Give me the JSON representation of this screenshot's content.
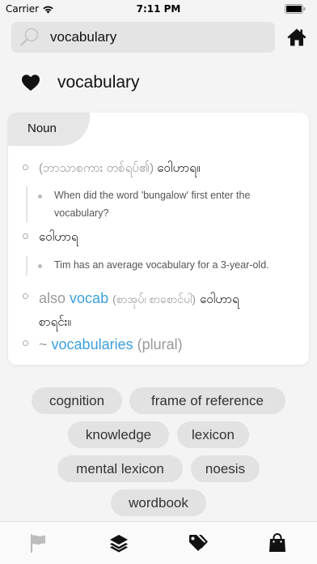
{
  "status_bar": {
    "carrier": "Carrier",
    "time": "7:11 PM"
  },
  "search": {
    "value": "vocabulary"
  },
  "entry": {
    "headword": "vocabulary",
    "part_of_speech": "Noun",
    "definition_1": {
      "note": "(ဘာသာစကား တစ်ရပ်၏)",
      "gloss": "ဝေါဟာရ။"
    },
    "example_1": "When did the word 'bungalow' first enter the vocabulary?",
    "definition_2": {
      "gloss": "ဝေါဟာရ"
    },
    "example_2": "Tim has an average vocabulary for a 3-year-old.",
    "variant": {
      "prefix": "also",
      "word": "vocab",
      "note": "(စာအုပ်၊ စာစောင်ပါ)",
      "gloss": "ဝေါဟာရ",
      "gloss_cont": "စာရင်း။"
    },
    "plural": {
      "tilde": "~",
      "word": "vocabularies",
      "label": "(plural)"
    }
  },
  "related_tags": [
    "cognition",
    "frame of reference",
    "knowledge",
    "lexicon",
    "mental lexicon",
    "noesis",
    "wordbook"
  ],
  "tab_bar": {
    "items": [
      "flag-icon",
      "layers-icon",
      "tags-icon",
      "shopping-bag-icon"
    ],
    "active_color": "#111111",
    "inactive_color": "#bbbbbb"
  },
  "colors": {
    "accent_blue": "#3b9fdc",
    "background": "#f4f4f4",
    "tag_background": "#e2e2e2"
  }
}
